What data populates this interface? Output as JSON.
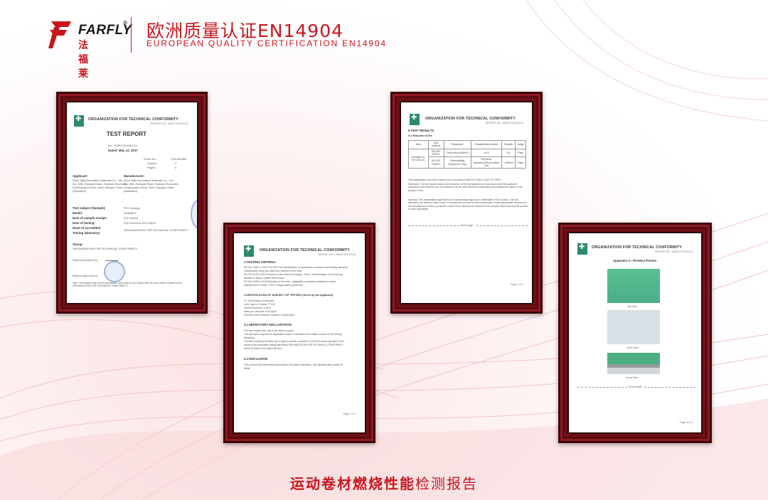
{
  "brand": {
    "name_en": "FARFLY",
    "registered_mark": "®",
    "name_cn": "法福莱",
    "colors": {
      "primary": "#c8161d",
      "frame": "#6e0f16"
    }
  },
  "header": {
    "title_cn": "欧洲质量认证EN14904",
    "title_en": "EUROPEAN QUALITY CERTIFICATION EN14904"
  },
  "documents": [
    {
      "org": "ORGANIZATION FOR TECHNICAL CONFORMITY",
      "report_no": "REPORT NO.: HQR17021904-01",
      "title": "TEST REPORT",
      "no": "No.: HQR17021904-01",
      "dated": "Dated:  May 12, 2017",
      "meta": [
        {
          "label": "Order No.:",
          "value": "1701000869"
        },
        {
          "label": "Copies:",
          "value": "2"
        },
        {
          "label": "Pages:",
          "value": "4"
        }
      ],
      "applicant_label": "Applicant:",
      "manufacturer_label": "Manufacturer:",
      "applicant_lines": [
        "Wuxi Taifa Decoration Material Co., Ltd.",
        "No. 286, Zhongfa Road, Huishan Economic",
        "Development Area, Wuxi Jiangsu China",
        "(Mainland)"
      ],
      "manufacturer_lines": [
        "Wuxi Taifa Decoration Material Co., Ltd.",
        "No. 286, Zhongfa Road, Huishan Economic",
        "Development Area, Wuxi Jiangsu China",
        "(Mainland)"
      ],
      "fields": [
        {
          "label": "Test subject (Sample):",
          "value": "PVC flooring"
        },
        {
          "label": "Model:",
          "value": "SS460KG"
        },
        {
          "label": "Date of sample receipt:",
          "value": "2017/04/18"
        },
        {
          "label": "Date of testing:",
          "value": "2017/04/18 to 2017/05/12"
        },
        {
          "label": "Head of accredited",
          "value": ""
        },
        {
          "label": "Testing laboratory:",
          "value": "ORGANIZATION FOR TECHNICAL CONFORMITY"
        }
      ],
      "stamp_label": "Stamp:",
      "stamp_org": "ORGANIZATION FOR TECHNICAL CONFORMITY",
      "prepared": "Report prepared by:",
      "approved": "Report Approved by:",
      "note": "Note: This Report may not be reproduced, other than in full, except with the prior written consent of the ORGANIZATION FOR TECHNICAL CONFORMITY."
    },
    {
      "org": "ORGANIZATION FOR TECHNICAL CONFORMITY",
      "report_no": "REPORT NO.: HQR17021904-01",
      "sections": [
        {
          "heading": "1.TESTING CRITERIA",
          "lines": [
            "EN ISO 13501-1:2007+A1:2009 Fire classification of construction products and building elements.",
            "Classification using test data from reaction to fire tests.",
            "EN ISO 9239-1:2010 Reaction to fire tests for floorings - Part 1: Determination of the burning",
            "behaviour using a radiant heat source.",
            "EN ISO 11925-2:2010 Reaction to fire tests - Ignitability of products subjected to direct",
            "impingement of flame - Part 2: Single-flame source test."
          ]
        },
        {
          "heading": "2.SPECIFICATION OF SUBJECT OF TESTING (Given by the applicant)",
          "lines": [
            "2.1 Specification of samples",
            "Color: green; Pantone 7724C",
            "Overall thickness: 6.1mm",
            "Mass per unit area: 8.16 kg/m²",
            "Purpose of the products: located in Sports Area"
          ]
        },
        {
          "heading": "3.LABORATORY DECLARATION",
          "lines": [
            "The test results refer only to the tested product.",
            "The test report may not be duplicated except in full without the written consent of the testing",
            "laboratory.",
            "The client ordering the tests has a right to submit comments on the test results specified in the",
            "report of the accredited testing laboratory ORGANIZATION FOR TECHNICAL CONFORMITY",
            "within 15 days of the report delivery."
          ]
        },
        {
          "heading": "4.CONCLUSION",
          "lines": [
            "This product has been tested according to the above standards. See following test results for",
            "detail."
          ]
        }
      ],
      "page": "Page 2 of 4"
    },
    {
      "org": "ORGANIZATION FOR TECHNICAL CONFORMITY",
      "report_no": "REPORT NO.: HQR17021904-01",
      "heading": "5.TEST RESULTS",
      "subheading": "5.1  Reaction to fire",
      "table_header": [
        "Item",
        "Test method",
        "Parameter",
        "Classification criteria",
        "Results",
        "Judge"
      ],
      "table_rows": [
        [
          "Reaction to fire (Cfl-s1)",
          "EN ISO 9239-1",
          "Critical flux (kW/m²)",
          "≥4.5",
          "9.1",
          "Pass"
        ],
        [
          "",
          "EN ISO 11925-2",
          "Flammability (Exposure=15s)",
          "Fs(Flame spread)≤150mm within 20s",
          "<150mm",
          "Pass"
        ]
      ],
      "classification_note": "This classification has been carried out in accordance with EN 13501-1:2007+A1:2009.",
      "statement": "Statement: The test results relate to the behaviour of the test specimens of a product under the particular conditions of the test;they are not intended to be the sole criterion for assessing the potential fire hazard of the product in use.",
      "warning": "Warning: This classification report does not represent type approval or certification of the product. The test laboratory has therefore play no part in sampling the product for the test,although it holds appropriate references to the manufacturer's factory production control that is aimed to be relevant to the samples tested,and that will provide for their traceability.",
      "end": "End of page",
      "page": "Page 3 of 4"
    },
    {
      "org": "ORGANIZATION FOR TECHNICAL CONFORMITY",
      "report_no": "REPORT NO.: HQR17021904-01",
      "appendix": "Appendix A—Product Photos",
      "captions": [
        "Top View",
        "Back View",
        "Cross View"
      ],
      "end": "End of report",
      "page": "Page 4 of 4"
    }
  ],
  "footer": {
    "title_strong": "运动卷材燃烧性能",
    "title_normal": "检测报告"
  }
}
